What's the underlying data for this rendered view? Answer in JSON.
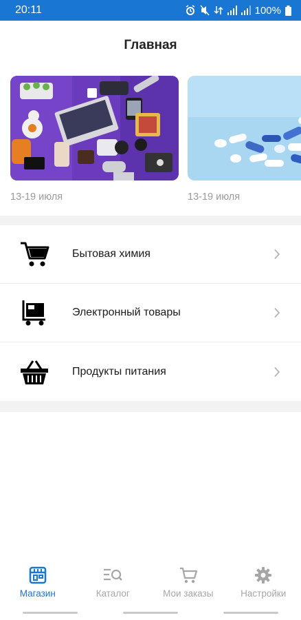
{
  "status_bar": {
    "time": "20:11",
    "battery": "100%"
  },
  "header": {
    "title": "Главная"
  },
  "promos": [
    {
      "date": "13-19 июля",
      "image": "electronics-flatlay"
    },
    {
      "date": "13-19 июля",
      "image": "pills"
    }
  ],
  "categories": [
    {
      "label": "Бытовая химия",
      "icon": "shopping-cart-icon"
    },
    {
      "label": "Электронный товары",
      "icon": "electronics-cart-icon"
    },
    {
      "label": "Продукты питания",
      "icon": "food-basket-icon"
    }
  ],
  "tabs": [
    {
      "label": "Магазин",
      "icon": "store-icon",
      "active": true
    },
    {
      "label": "Каталог",
      "icon": "catalog-search-icon",
      "active": false
    },
    {
      "label": "Мои заказы",
      "icon": "orders-cart-icon",
      "active": false
    },
    {
      "label": "Настройки",
      "icon": "gear-icon",
      "active": false
    }
  ],
  "colors": {
    "accent": "#1976d2",
    "inactive": "#a6a6a6",
    "divider": "#f2f2f2"
  }
}
